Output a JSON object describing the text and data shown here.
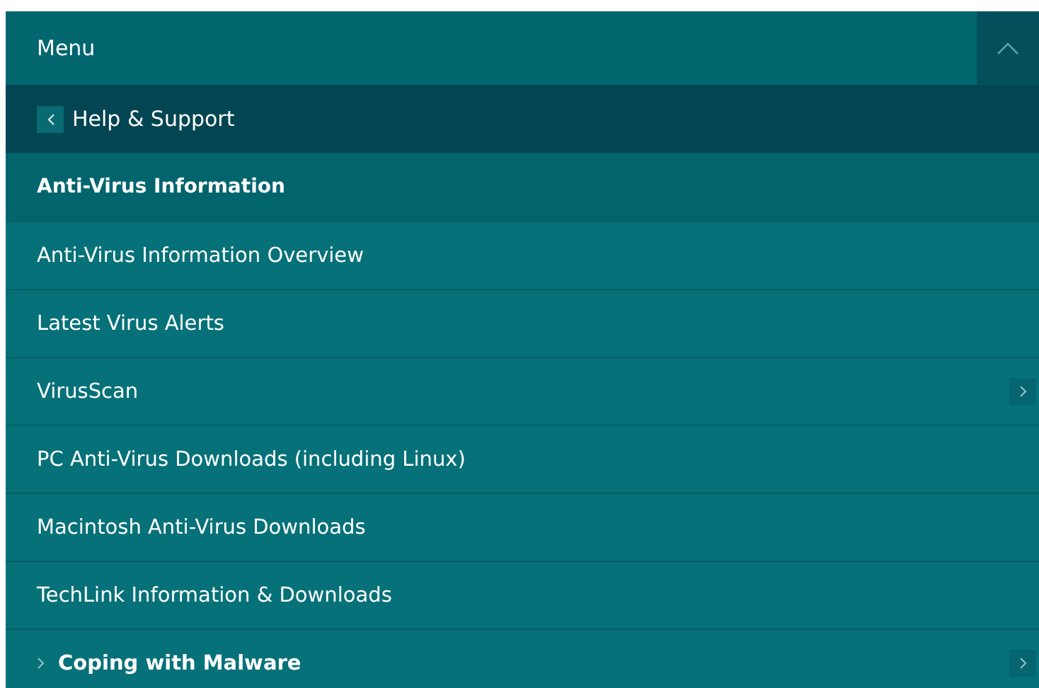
{
  "menu": {
    "title": "Menu",
    "expanded": true
  },
  "back": {
    "label": "Help & Support"
  },
  "section": {
    "title": "Anti-Virus Information"
  },
  "items": [
    {
      "kind": "link",
      "label": "Anti-Virus Information Overview",
      "has_submenu": false
    },
    {
      "kind": "link",
      "label": "Latest Virus Alerts",
      "has_submenu": false
    },
    {
      "kind": "link",
      "label": "VirusScan",
      "has_submenu": true
    },
    {
      "kind": "link",
      "label": "PC Anti-Virus Downloads (including Linux)",
      "has_submenu": false
    },
    {
      "kind": "link",
      "label": "Macintosh Anti-Virus Downloads",
      "has_submenu": false
    },
    {
      "kind": "link",
      "label": "TechLink Information & Downloads",
      "has_submenu": false
    },
    {
      "kind": "group",
      "label": "Coping with Malware",
      "has_submenu": true
    }
  ]
}
